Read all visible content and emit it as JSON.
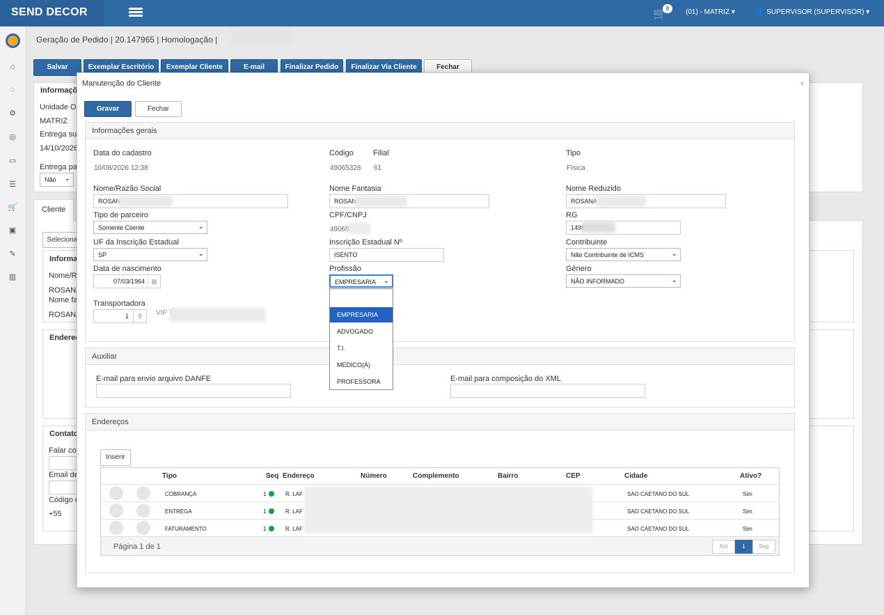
{
  "topbar": {
    "brand": "SEND DECOR",
    "cart_count": "0",
    "unit": "(01) - MATRIZ",
    "user": "SUPERVISOR (SUPERVISOR)"
  },
  "page": {
    "breadcrumb": "Geração de Pedido | 20.147965 | Homologação |"
  },
  "toolbar": {
    "salvar": "Salvar",
    "exemplar_escritorio": "Exemplar Escritório",
    "exemplar_cliente": "Exemplar Cliente",
    "email": "E-mail",
    "finalizar_pedido": "Finalizar Pedido",
    "finalizar_via_cliente": "Finalizar Via Cliente",
    "fechar": "Fechar"
  },
  "background": {
    "info_header": "Informações",
    "unidade_label": "Unidade Op",
    "matriz": "MATRIZ",
    "entrega_sup": "Entrega sup",
    "entrega_date": "14/10/2026",
    "entrega_pa": "Entrega pa",
    "nao": "Não",
    "tab_cliente": "Cliente",
    "selecionar": "Selecionar",
    "informacoes2": "Informaç",
    "nome_razao": "Nome/Ra",
    "rosana1": "ROSANA",
    "nome_fantasia": "Nome fa",
    "rosana2": "ROSANA",
    "enderecos": "Endereço",
    "contato": "Contato",
    "falar_com": "Falar com",
    "email_de": "Email de",
    "codigo": "Código d",
    "plus55": "+55"
  },
  "modal": {
    "title": "Manutenção do Cliente",
    "close": "×",
    "gravar": "Gravar",
    "fechar": "Fechar",
    "info_gerais": "Informações gerais",
    "data_cadastro_label": "Data do cadastro",
    "data_cadastro": "10/08/2026 12:38",
    "codigo_label": "Código",
    "codigo": "49065328",
    "filial_label": "Filial",
    "filial": "61",
    "tipo_label": "Tipo",
    "tipo": "Física",
    "nome_razao_label": "Nome/Razão Social",
    "nome_razao": "ROSANA",
    "nome_fantasia_label": "Nome Fantasia",
    "nome_fantasia": "ROSANA",
    "nome_reduzido_label": "Nome Reduzido",
    "nome_reduzido": "ROSANA",
    "tipo_parceiro_label": "Tipo de parceiro",
    "tipo_parceiro": "Somente Cliente",
    "cpf_label": "CPF/CNPJ",
    "cpf": "49065",
    "rg_label": "RG",
    "rg": "1498",
    "uf_label": "UF da Inscrição Estadual",
    "uf": "SP",
    "ie_label": "Inscrição Estadual Nº",
    "ie": "ISENTO",
    "contribuinte_label": "Contribuinte",
    "contribuinte": "Não Contribuinte de ICMS",
    "nascimento_label": "Data de nascimento",
    "nascimento": "07/03/1964",
    "profissao_label": "Profissão",
    "profissao": "EMPRESARIA",
    "genero_label": "Gênero",
    "genero": "NÃO INFORMADO",
    "transportadora_label": "Transportadora",
    "transportadora": "1",
    "transportadora_nome": "VIP T",
    "profissao_options": [
      "",
      "EMPRESARIA",
      "ADVOGADO",
      "T.I.",
      "MEDICO(A)",
      "PROFESSORA"
    ],
    "auxiliar": "Auxiliar",
    "email_danfe_label": "E-mail para envio arquivo DANFE",
    "email_xml_label": "E-mail para composição do XML",
    "enderecos": "Endereços",
    "inserir": "Inserir",
    "columns": [
      "Tipo",
      "Seq",
      "Endereço",
      "Número",
      "Complemento",
      "Bairro",
      "CEP",
      "Cidade",
      "Ativo?"
    ],
    "rows": [
      {
        "tipo": "COBRANÇA",
        "seq": "1",
        "endereco": "R. LAF",
        "cidade": "SAO CAETANO DO SUL",
        "ativo": "Sim"
      },
      {
        "tipo": "ENTREGA",
        "seq": "1",
        "endereco": "R. LAF",
        "cidade": "SAO CAETANO DO SUL",
        "ativo": "Sim"
      },
      {
        "tipo": "FATURAMENTO",
        "seq": "1",
        "endereco": "R. LAF",
        "cidade": "SAO CAETANO DO SUL",
        "ativo": "Sim"
      }
    ],
    "pagina": "Página 1 de 1",
    "ant": "Ant",
    "page_num": "1",
    "seg": "Seg"
  }
}
